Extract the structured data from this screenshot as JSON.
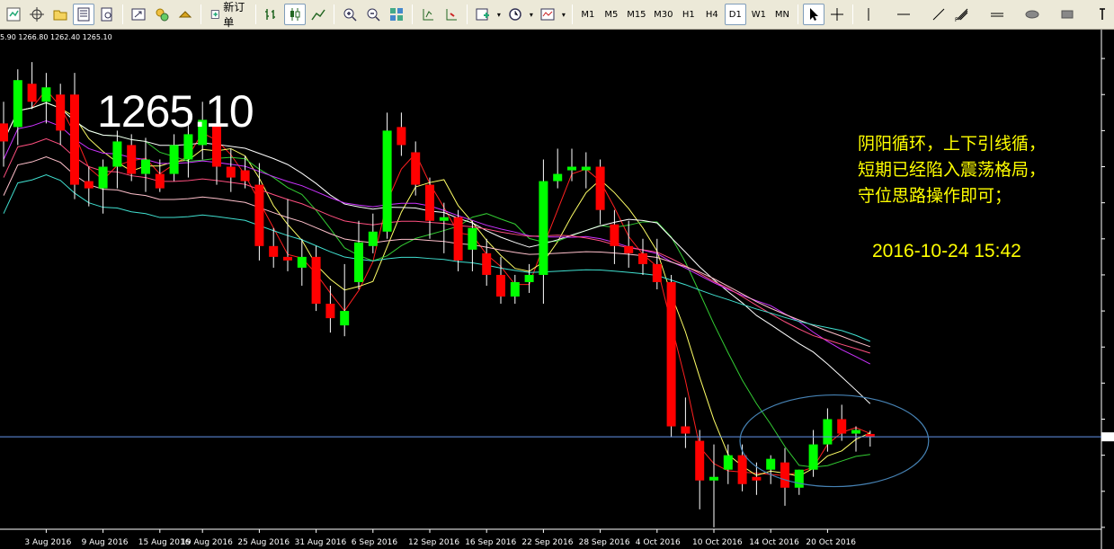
{
  "toolbar": {
    "new_order_label": "新订单",
    "timeframes": [
      "M1",
      "M5",
      "M15",
      "M30",
      "H1",
      "H4",
      "D1",
      "W1",
      "MN"
    ],
    "active_timeframe": "D1"
  },
  "chart_header": {
    "ohlc_text": "5.90 1266.80 1262.40 1265.10"
  },
  "price_label": "1265.10",
  "annotation": {
    "lines": [
      "阴阳循环，上下引线循，",
      "短期已经陷入震荡格局，",
      "守位思路操作即可；"
    ],
    "date": "2016-10-24 15:42"
  },
  "colors": {
    "background": "#000000",
    "bull": "#00ff00",
    "bear": "#ff0000",
    "wick": "#ffffff",
    "text": "#ffffff",
    "annotation": "#ffff00",
    "price_line": "#6495ed",
    "ellipse": "#4682b4",
    "ma_red": "#ff2020",
    "ma_yellow": "#ffff66",
    "ma_green": "#33cc33",
    "ma_white": "#ffffff",
    "ma_magenta": "#cc33ff",
    "ma_pink": "#ff4f7f",
    "ma_lightpink": "#ffc0cb",
    "ma_cyan": "#40e0d0"
  },
  "chart_data": {
    "type": "candlestick",
    "instrument_price_current": 1265.1,
    "x_ticks": [
      "3 Aug 2016",
      "9 Aug 2016",
      "15 Aug 2016",
      "19 Aug 2016",
      "25 Aug 2016",
      "31 Aug 2016",
      "6 Sep 2016",
      "12 Sep 2016",
      "16 Sep 2016",
      "22 Sep 2016",
      "28 Sep 2016",
      "4 Oct 2016",
      "10 Oct 2016",
      "14 Oct 2016",
      "20 Oct 2016"
    ],
    "y_range": [
      1234,
      1378
    ],
    "candles": [
      {
        "date": "2016-07-29",
        "o": 1352,
        "h": 1358,
        "l": 1340,
        "c": 1347
      },
      {
        "date": "2016-08-01",
        "o": 1351,
        "h": 1367,
        "l": 1346,
        "c": 1364
      },
      {
        "date": "2016-08-02",
        "o": 1363,
        "h": 1369,
        "l": 1356,
        "c": 1358
      },
      {
        "date": "2016-08-03",
        "o": 1358,
        "h": 1366,
        "l": 1352,
        "c": 1362
      },
      {
        "date": "2016-08-04",
        "o": 1360,
        "h": 1363,
        "l": 1346,
        "c": 1350
      },
      {
        "date": "2016-08-05",
        "o": 1360,
        "h": 1366,
        "l": 1331,
        "c": 1335
      },
      {
        "date": "2016-08-08",
        "o": 1336,
        "h": 1340,
        "l": 1329,
        "c": 1334
      },
      {
        "date": "2016-08-09",
        "o": 1334,
        "h": 1342,
        "l": 1327,
        "c": 1340
      },
      {
        "date": "2016-08-10",
        "o": 1340,
        "h": 1350,
        "l": 1334,
        "c": 1347
      },
      {
        "date": "2016-08-11",
        "o": 1346,
        "h": 1349,
        "l": 1336,
        "c": 1338
      },
      {
        "date": "2016-08-12",
        "o": 1338,
        "h": 1348,
        "l": 1333,
        "c": 1342
      },
      {
        "date": "2016-08-15",
        "o": 1338,
        "h": 1342,
        "l": 1333,
        "c": 1334
      },
      {
        "date": "2016-08-16",
        "o": 1338,
        "h": 1349,
        "l": 1336,
        "c": 1346
      },
      {
        "date": "2016-08-17",
        "o": 1342,
        "h": 1355,
        "l": 1337,
        "c": 1349
      },
      {
        "date": "2016-08-18",
        "o": 1346,
        "h": 1358,
        "l": 1342,
        "c": 1353
      },
      {
        "date": "2016-08-19",
        "o": 1352,
        "h": 1356,
        "l": 1335,
        "c": 1340
      },
      {
        "date": "2016-08-22",
        "o": 1340,
        "h": 1345,
        "l": 1333,
        "c": 1337
      },
      {
        "date": "2016-08-23",
        "o": 1339,
        "h": 1343,
        "l": 1334,
        "c": 1336
      },
      {
        "date": "2016-08-24",
        "o": 1335,
        "h": 1341,
        "l": 1314,
        "c": 1318
      },
      {
        "date": "2016-08-25",
        "o": 1318,
        "h": 1323,
        "l": 1312,
        "c": 1315
      },
      {
        "date": "2016-08-26",
        "o": 1315,
        "h": 1331,
        "l": 1311,
        "c": 1314
      },
      {
        "date": "2016-08-29",
        "o": 1312,
        "h": 1320,
        "l": 1307,
        "c": 1315
      },
      {
        "date": "2016-08-30",
        "o": 1315,
        "h": 1318,
        "l": 1300,
        "c": 1302
      },
      {
        "date": "2016-08-31",
        "o": 1302,
        "h": 1307,
        "l": 1294,
        "c": 1298
      },
      {
        "date": "2016-09-01",
        "o": 1296,
        "h": 1313,
        "l": 1293,
        "c": 1300
      },
      {
        "date": "2016-09-02",
        "o": 1308,
        "h": 1325,
        "l": 1306,
        "c": 1319
      },
      {
        "date": "2016-09-05",
        "o": 1318,
        "h": 1327,
        "l": 1316,
        "c": 1322
      },
      {
        "date": "2016-09-06",
        "o": 1322,
        "h": 1355,
        "l": 1320,
        "c": 1350
      },
      {
        "date": "2016-09-07",
        "o": 1351,
        "h": 1355,
        "l": 1343,
        "c": 1346
      },
      {
        "date": "2016-09-08",
        "o": 1344,
        "h": 1347,
        "l": 1332,
        "c": 1335
      },
      {
        "date": "2016-09-09",
        "o": 1335,
        "h": 1337,
        "l": 1320,
        "c": 1325
      },
      {
        "date": "2016-09-12",
        "o": 1325,
        "h": 1330,
        "l": 1316,
        "c": 1326
      },
      {
        "date": "2016-09-13",
        "o": 1326,
        "h": 1328,
        "l": 1311,
        "c": 1314
      },
      {
        "date": "2016-09-14",
        "o": 1317,
        "h": 1325,
        "l": 1311,
        "c": 1323
      },
      {
        "date": "2016-09-15",
        "o": 1316,
        "h": 1320,
        "l": 1307,
        "c": 1310
      },
      {
        "date": "2016-09-16",
        "o": 1310,
        "h": 1315,
        "l": 1302,
        "c": 1304
      },
      {
        "date": "2016-09-19",
        "o": 1304,
        "h": 1310,
        "l": 1302,
        "c": 1308
      },
      {
        "date": "2016-09-20",
        "o": 1308,
        "h": 1313,
        "l": 1305,
        "c": 1310
      },
      {
        "date": "2016-09-21",
        "o": 1310,
        "h": 1342,
        "l": 1302,
        "c": 1336
      },
      {
        "date": "2016-09-22",
        "o": 1336,
        "h": 1345,
        "l": 1334,
        "c": 1338
      },
      {
        "date": "2016-09-23",
        "o": 1339,
        "h": 1345,
        "l": 1336,
        "c": 1340
      },
      {
        "date": "2016-09-26",
        "o": 1339,
        "h": 1344,
        "l": 1334,
        "c": 1340
      },
      {
        "date": "2016-09-27",
        "o": 1340,
        "h": 1342,
        "l": 1324,
        "c": 1328
      },
      {
        "date": "2016-09-28",
        "o": 1324,
        "h": 1328,
        "l": 1313,
        "c": 1318
      },
      {
        "date": "2016-09-29",
        "o": 1318,
        "h": 1325,
        "l": 1312,
        "c": 1316
      },
      {
        "date": "2016-09-30",
        "o": 1316,
        "h": 1320,
        "l": 1310,
        "c": 1313
      },
      {
        "date": "2016-10-03",
        "o": 1313,
        "h": 1320,
        "l": 1306,
        "c": 1308
      },
      {
        "date": "2016-10-04",
        "o": 1308,
        "h": 1310,
        "l": 1265,
        "c": 1268
      },
      {
        "date": "2016-10-05",
        "o": 1268,
        "h": 1276,
        "l": 1262,
        "c": 1266
      },
      {
        "date": "2016-10-06",
        "o": 1264,
        "h": 1267,
        "l": 1245,
        "c": 1253
      },
      {
        "date": "2016-10-07",
        "o": 1253,
        "h": 1263,
        "l": 1240,
        "c": 1254
      },
      {
        "date": "2016-10-10",
        "o": 1256,
        "h": 1263,
        "l": 1252,
        "c": 1260
      },
      {
        "date": "2016-10-11",
        "o": 1260,
        "h": 1263,
        "l": 1250,
        "c": 1252
      },
      {
        "date": "2016-10-12",
        "o": 1254,
        "h": 1258,
        "l": 1249,
        "c": 1253
      },
      {
        "date": "2016-10-13",
        "o": 1256,
        "h": 1260,
        "l": 1252,
        "c": 1259
      },
      {
        "date": "2016-10-14",
        "o": 1258,
        "h": 1262,
        "l": 1246,
        "c": 1251
      },
      {
        "date": "2016-10-17",
        "o": 1251,
        "h": 1256,
        "l": 1249,
        "c": 1256
      },
      {
        "date": "2016-10-18",
        "o": 1256,
        "h": 1267,
        "l": 1254,
        "c": 1263
      },
      {
        "date": "2016-10-19",
        "o": 1263,
        "h": 1273,
        "l": 1261,
        "c": 1270
      },
      {
        "date": "2016-10-20",
        "o": 1270,
        "h": 1274,
        "l": 1264,
        "c": 1266
      },
      {
        "date": "2016-10-21",
        "o": 1266,
        "h": 1268,
        "l": 1261,
        "c": 1267
      },
      {
        "date": "2016-10-24",
        "o": 1265.9,
        "h": 1266.8,
        "l": 1262.4,
        "c": 1265.1
      }
    ]
  }
}
